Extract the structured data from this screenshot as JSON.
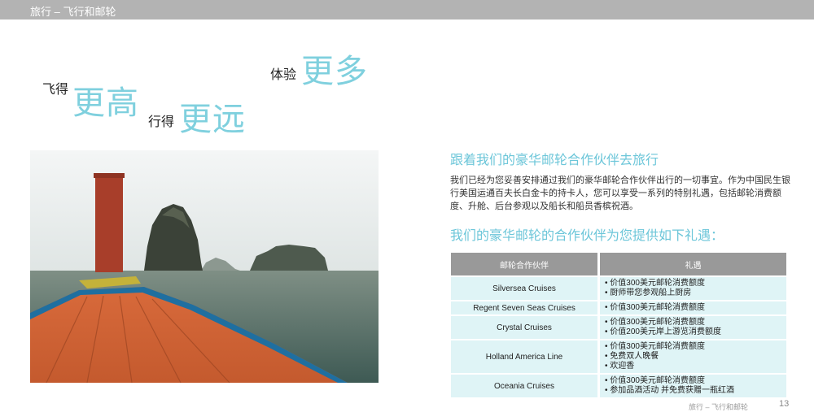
{
  "header": {
    "title": "旅行 – 飞行和邮轮"
  },
  "slogan": {
    "fly": "飞得",
    "higher": "更高",
    "go": "行得",
    "farther": "更远",
    "experience": "体验",
    "more": "更多"
  },
  "section1": {
    "title": "跟着我们的豪华邮轮合作伙伴去旅行",
    "body": "我们已经为您妥善安排通过我们的豪华邮轮合作伙伴出行的一切事宜。作为中国民生银行美国运通百夫长白金卡的持卡人，您可以享受一系列的特别礼遇，包括邮轮消费额度、升舱、后台参观以及船长和船员香槟祝酒。"
  },
  "section2": {
    "title": "我们的豪华邮轮的合作伙伴为您提供如下礼遇："
  },
  "table": {
    "headers": [
      "邮轮合作伙伴",
      "礼遇"
    ],
    "rows": [
      {
        "partner": "Silversea Cruises",
        "gifts": [
          "• 价值300美元邮轮消费额度",
          "• 厨师带您参观船上厨房"
        ]
      },
      {
        "partner": "Regent Seven Seas Cruises",
        "gifts": [
          "• 价值300美元邮轮消费额度"
        ]
      },
      {
        "partner": "Crystal Cruises",
        "gifts": [
          "• 价值300美元邮轮消费额度",
          "• 价值200美元岸上游览消费额度"
        ]
      },
      {
        "partner": "Holland America Line",
        "gifts": [
          "• 价值300美元邮轮消费额度",
          "• 免费双人晚餐",
          "• 欢迎香"
        ]
      },
      {
        "partner": "Oceania Cruises",
        "gifts": [
          "• 价值300美元邮轮消费额度",
          "• 参加品酒活动 并免费获赠一瓶红酒"
        ]
      }
    ]
  },
  "footer": {
    "section": "旅行 – 飞行和邮轮",
    "page": "13"
  },
  "colors": {
    "accent": "#7fd0de",
    "header_bar": "#b3b3b3",
    "table_header": "#999999",
    "table_cell": "#dff4f6"
  }
}
